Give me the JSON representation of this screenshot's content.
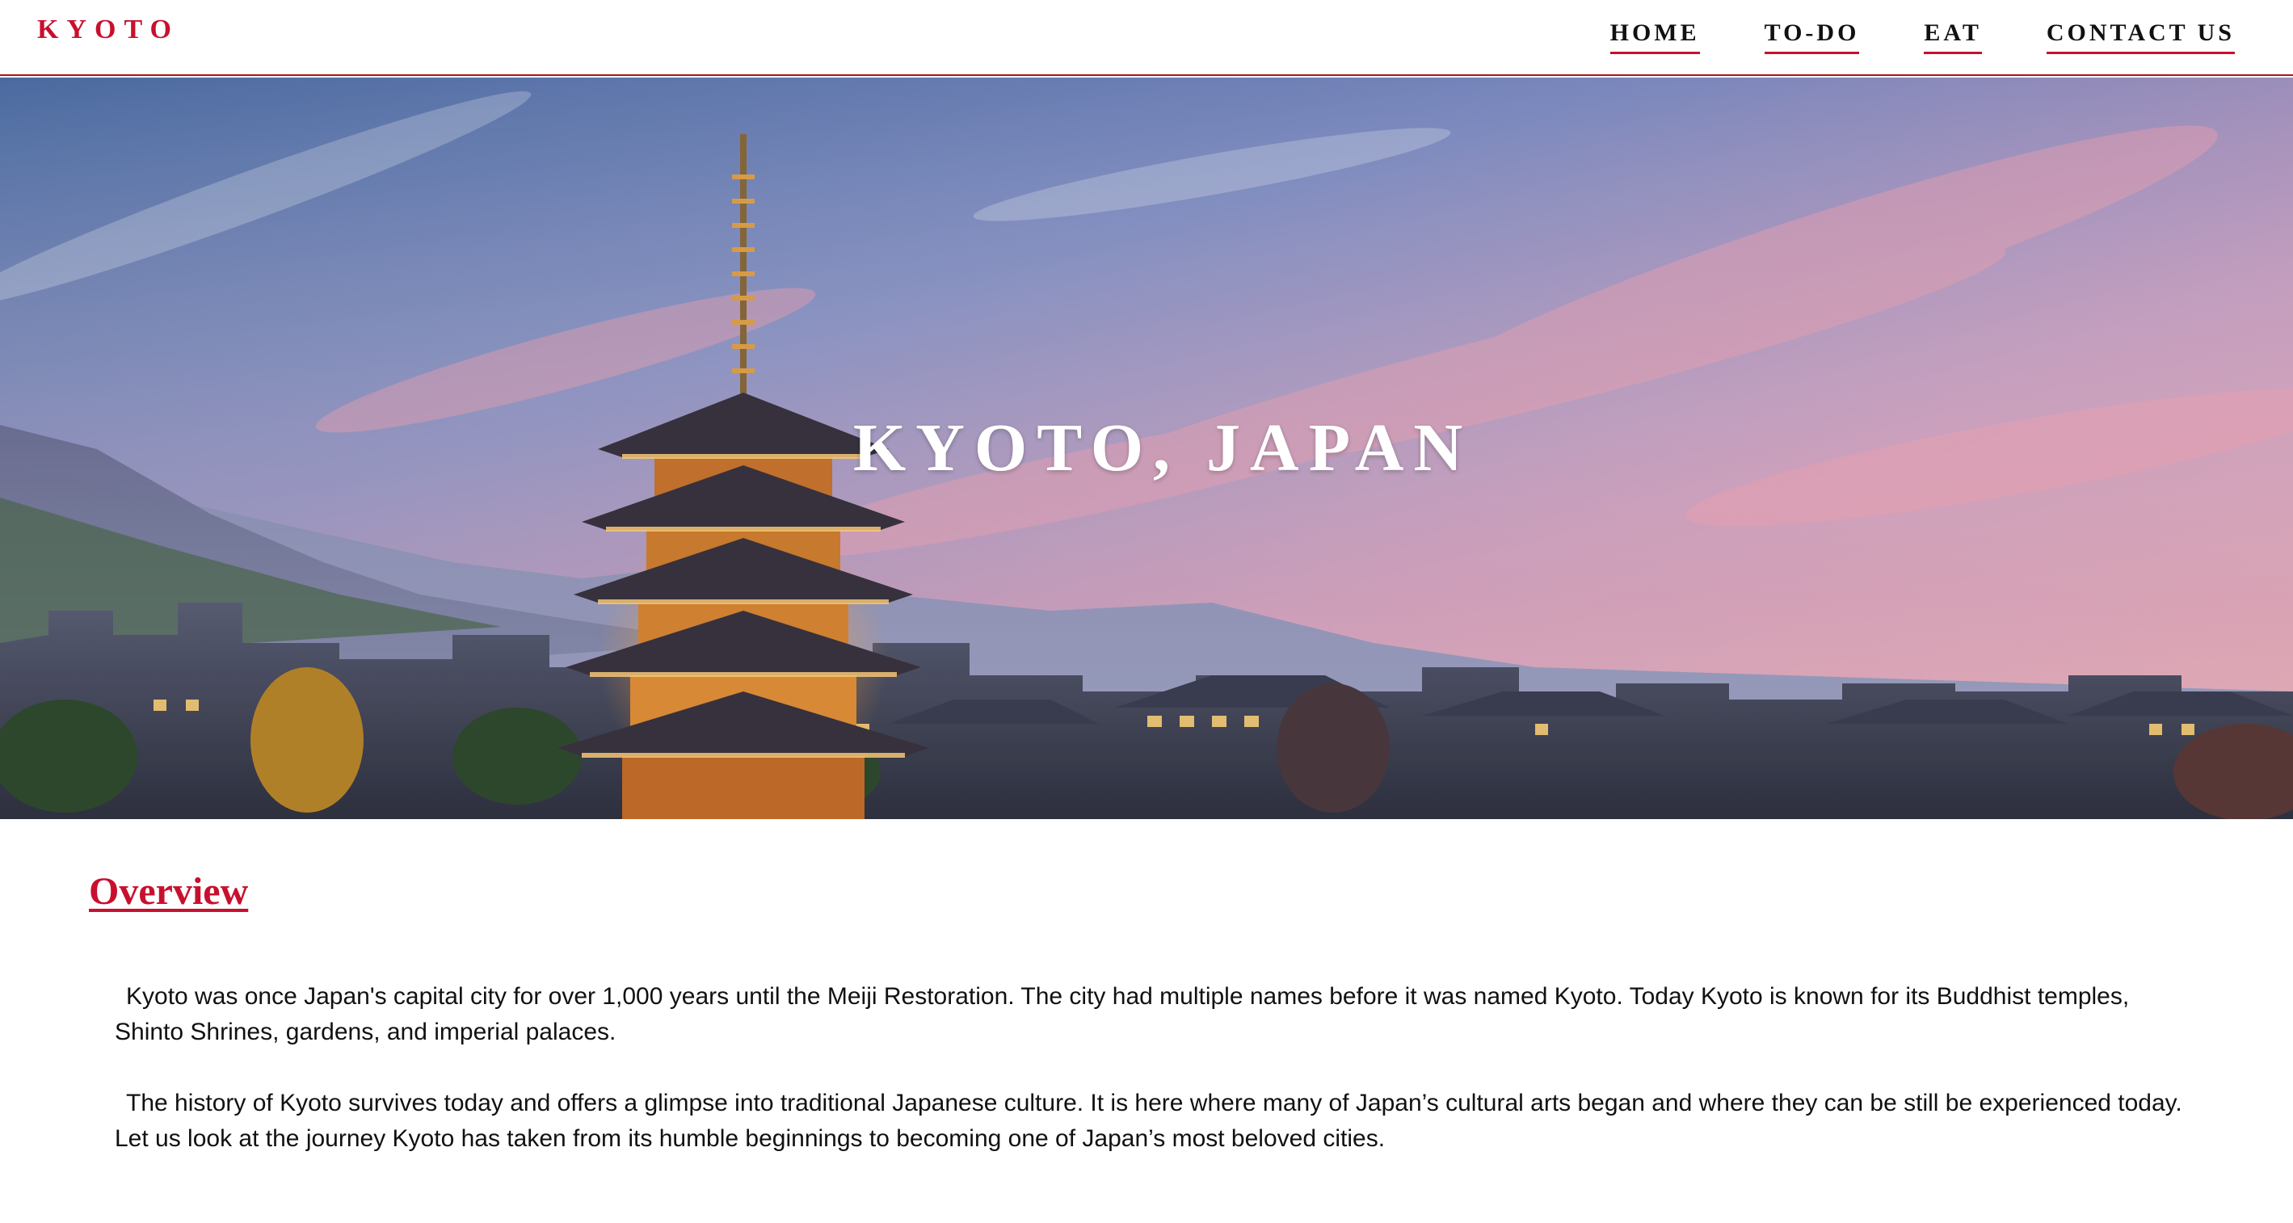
{
  "nav": {
    "brand": "KYOTO",
    "links": [
      "HOME",
      "TO-DO",
      "EAT",
      "CONTACT US"
    ]
  },
  "hero": {
    "title": "KYOTO, JAPAN",
    "image": "kyoto-pagoda-skyline-photo"
  },
  "overview": {
    "heading": "Overview",
    "paragraphs": [
      "Kyoto was once Japan's capital city for over 1,000 years until the Meiji Restoration. The city had multiple names before it was named Kyoto. Today Kyoto is known for its Buddhist temples, Shinto Shrines, gardens, and imperial palaces.",
      "The history of Kyoto survives today and offers a glimpse into traditional Japanese culture. It is here where many of Japan’s cultural arts began and where they can be still be experienced today. Let us look at the journey Kyoto has taken from its humble beginnings to becoming one of Japan’s most beloved cities."
    ]
  },
  "colors": {
    "accent": "#c8102e",
    "text": "#111111",
    "background": "#ffffff"
  }
}
